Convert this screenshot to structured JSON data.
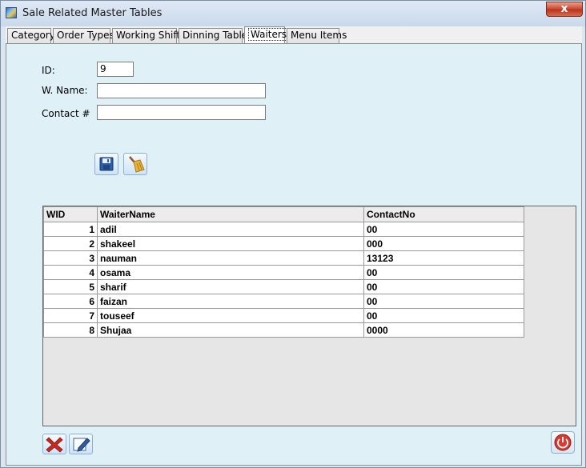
{
  "window": {
    "title": "Sale Related Master Tables",
    "close_label": "x"
  },
  "tabs": [
    {
      "label": "Category"
    },
    {
      "label": "Order Types"
    },
    {
      "label": "Working Shifts"
    },
    {
      "label": "Dinning Tables"
    },
    {
      "label": "Waiters",
      "active": true
    },
    {
      "label": "Menu Items"
    }
  ],
  "form": {
    "id_label": "ID:",
    "id_value": "9",
    "name_label": "W. Name:",
    "name_value": "",
    "contact_label": "Contact #",
    "contact_value": ""
  },
  "toolbar": {
    "save_icon": "floppy-disk-icon",
    "clear_icon": "broom-icon"
  },
  "grid": {
    "columns": [
      "WID",
      "WaiterName",
      "ContactNo"
    ],
    "rows": [
      {
        "wid": "1",
        "name": "adil",
        "contact": "00"
      },
      {
        "wid": "2",
        "name": "shakeel",
        "contact": "000"
      },
      {
        "wid": "3",
        "name": "nauman",
        "contact": "13123"
      },
      {
        "wid": "4",
        "name": "osama",
        "contact": "00"
      },
      {
        "wid": "5",
        "name": "sharif",
        "contact": "00"
      },
      {
        "wid": "6",
        "name": "faizan",
        "contact": "00"
      },
      {
        "wid": "7",
        "name": "touseef",
        "contact": "00"
      },
      {
        "wid": "8",
        "name": "Shujaa",
        "contact": "0000"
      }
    ]
  },
  "bottom_actions": {
    "delete_icon": "delete-x-icon",
    "edit_icon": "edit-pencil-icon",
    "exit_icon": "power-icon"
  },
  "colors": {
    "panel_bg": "#dff1f7",
    "close_red": "#c7462f",
    "delete_red": "#c8291f"
  }
}
